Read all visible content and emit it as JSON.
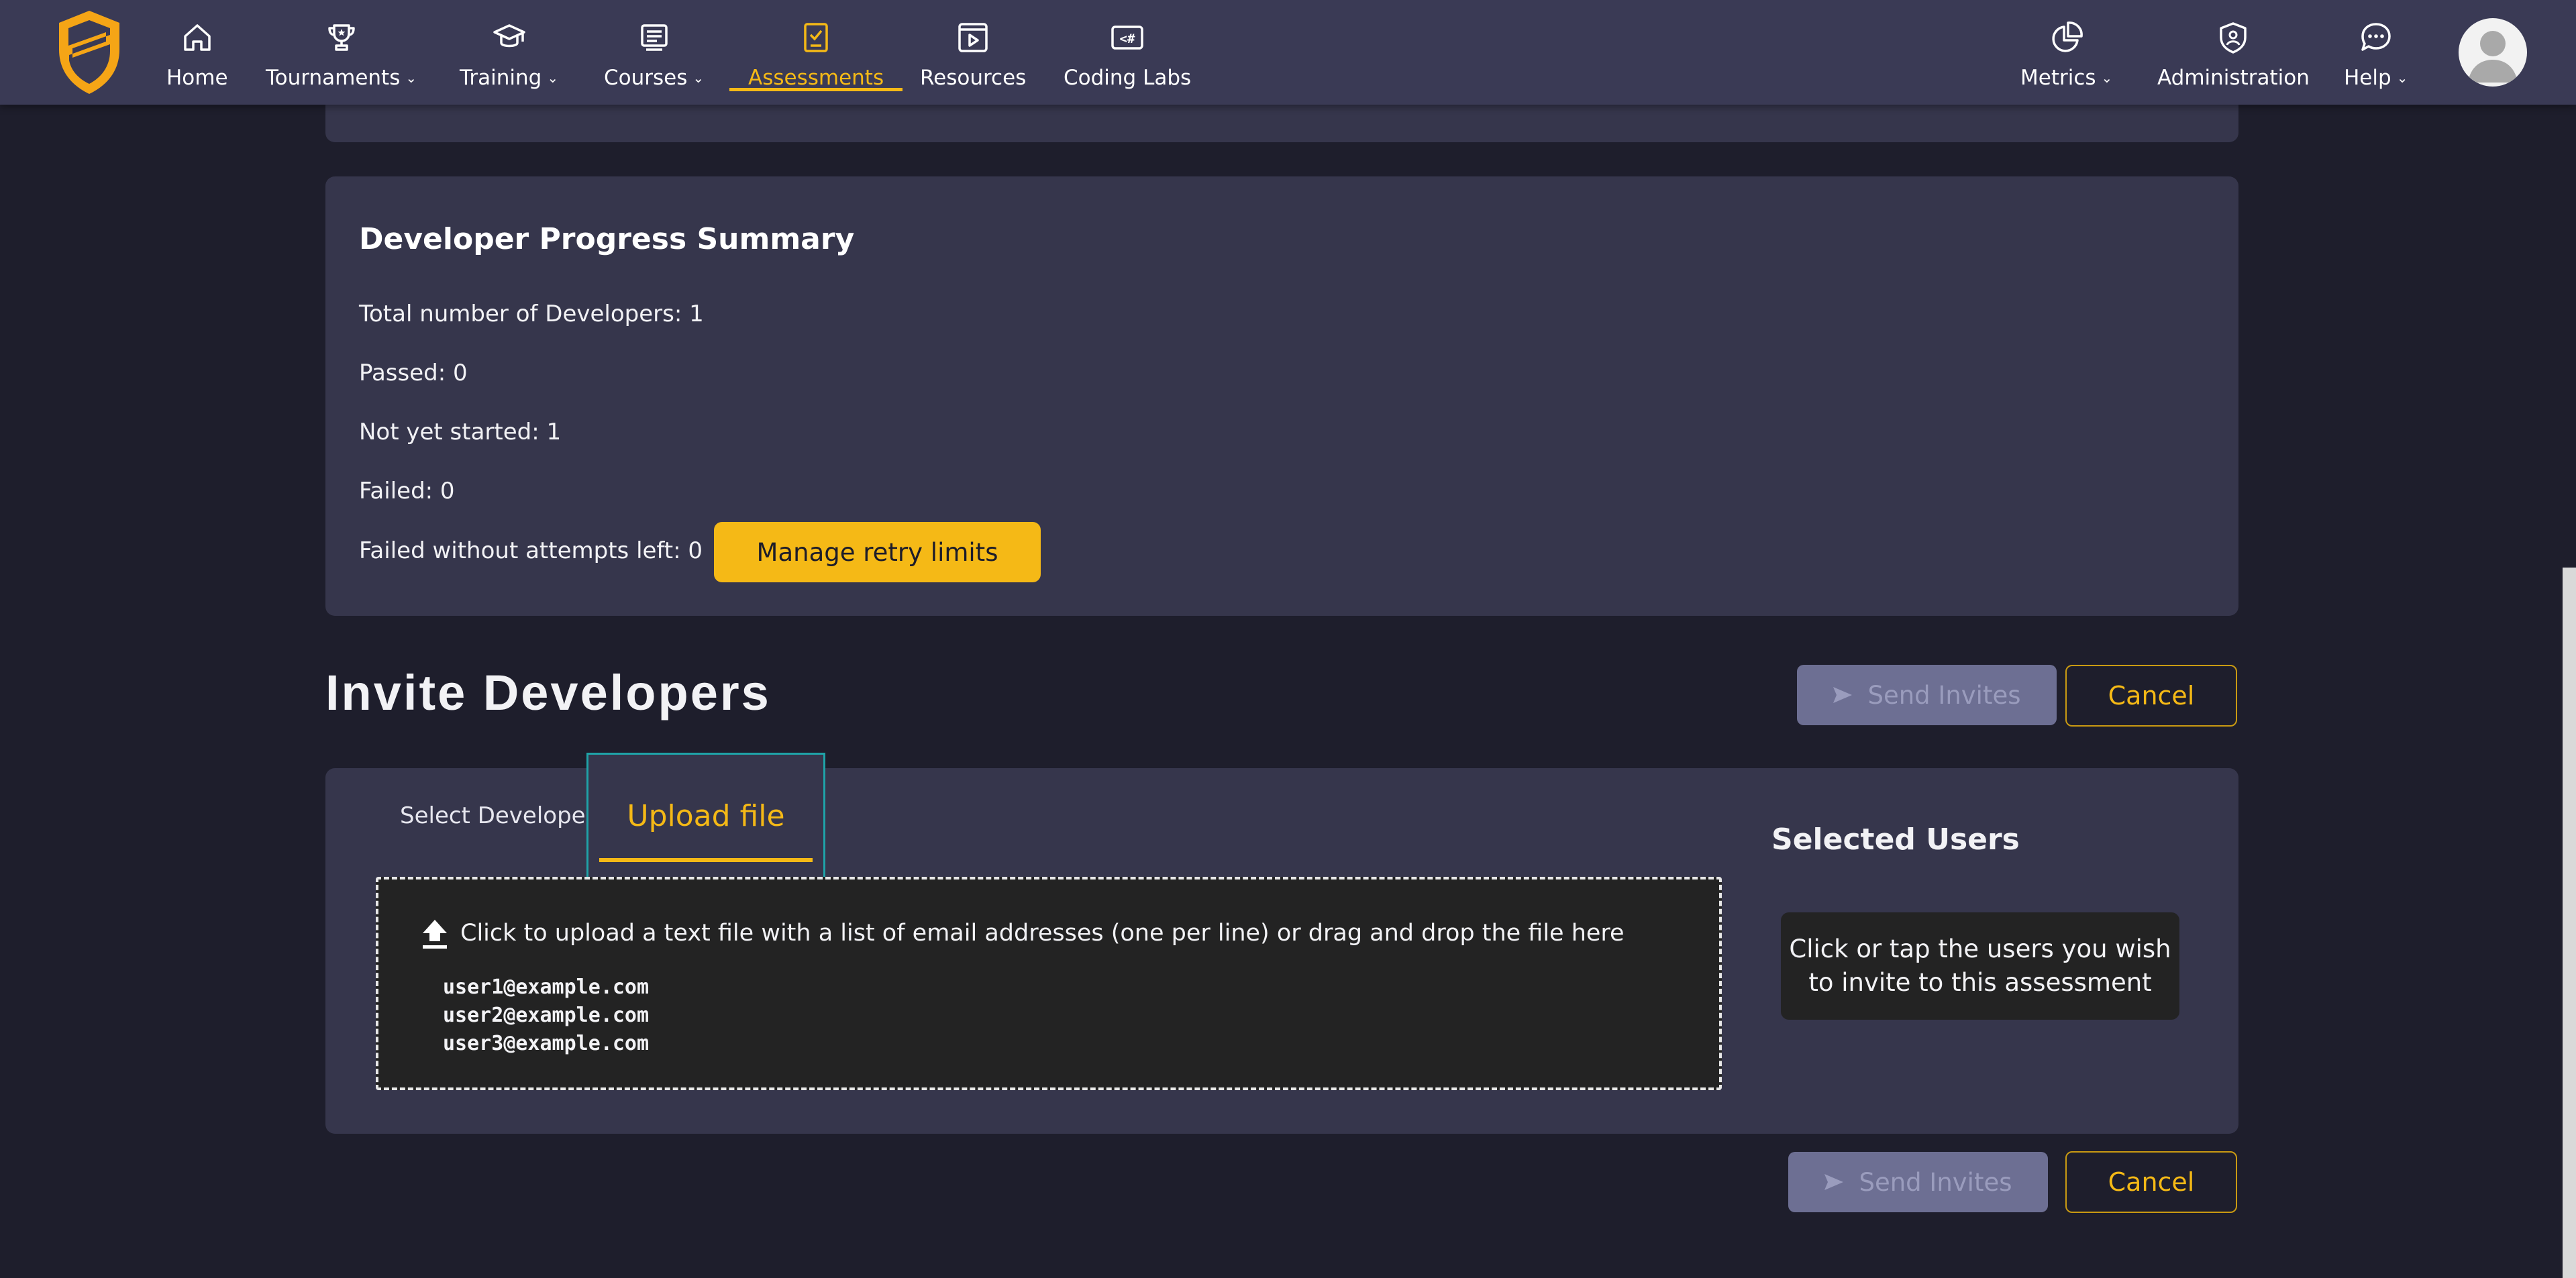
{
  "nav": {
    "left": [
      {
        "label": "Home",
        "icon": "home-icon",
        "dropdown": false
      },
      {
        "label": "Tournaments",
        "icon": "trophy-icon",
        "dropdown": true
      },
      {
        "label": "Training",
        "icon": "graduation-cap-icon",
        "dropdown": true
      },
      {
        "label": "Courses",
        "icon": "courses-icon",
        "dropdown": true
      },
      {
        "label": "Assessments",
        "icon": "assessment-checklist-icon",
        "dropdown": false,
        "active": true
      },
      {
        "label": "Resources",
        "icon": "video-play-icon",
        "dropdown": false
      },
      {
        "label": "Coding Labs",
        "icon": "code-hash-icon",
        "dropdown": false
      }
    ],
    "right": [
      {
        "label": "Metrics",
        "icon": "pie-chart-icon",
        "dropdown": true
      },
      {
        "label": "Administration",
        "icon": "admin-shield-icon",
        "dropdown": false
      },
      {
        "label": "Help",
        "icon": "help-chat-icon",
        "dropdown": true
      }
    ],
    "chevron": "⌄",
    "accent_color": "#f5b916"
  },
  "summary": {
    "title": "Developer Progress Summary",
    "total": "Total number of Developers: 1",
    "passed": "Passed: 0",
    "not_started": "Not yet started: 1",
    "failed": "Failed: 0",
    "failed_no_attempts": "Failed without attempts left: 0",
    "retry_button": "Manage retry limits"
  },
  "invite": {
    "title": "Invite Developers",
    "send_label": "Send Invites",
    "cancel_label": "Cancel",
    "tabs": {
      "select": "Select Developers",
      "upload": "Upload file"
    },
    "upload_hint": "Click to upload a text file with a list of email addresses (one per line) or drag and drop the file here",
    "example_emails": [
      "user1@example.com",
      "user2@example.com",
      "user3@example.com"
    ],
    "selected_title": "Selected Users",
    "selected_hint": "Click or tap the users you wish to invite to this assessment"
  }
}
